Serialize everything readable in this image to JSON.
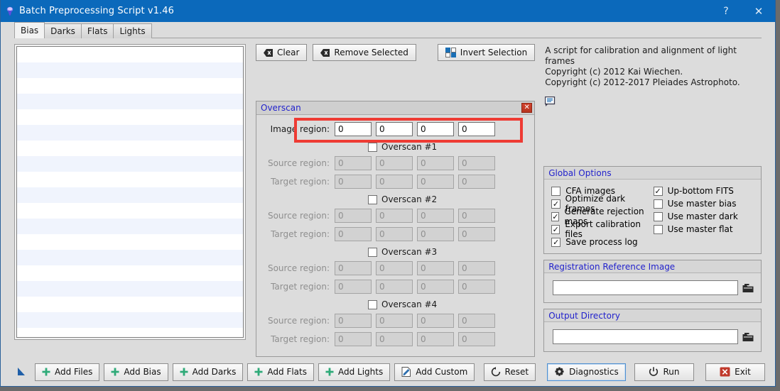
{
  "window": {
    "title": "Batch Preprocessing Script v1.46",
    "title_icon": "pixinsight-script-icon",
    "help_label": "?",
    "close_label": "✕",
    "titlebar_color": "#0b69bb"
  },
  "tabs": [
    {
      "label": "Bias",
      "active": true
    },
    {
      "label": "Darks",
      "active": false
    },
    {
      "label": "Flats",
      "active": false
    },
    {
      "label": "Lights",
      "active": false
    }
  ],
  "file_list": {
    "items": [],
    "row_count": 19
  },
  "toolbar": {
    "clear_label": "Clear",
    "remove_selected_label": "Remove Selected",
    "invert_selection_label": "Invert Selection"
  },
  "overscan": {
    "title": "Overscan",
    "close_label": "✕",
    "image_region": {
      "label": "Image region:",
      "values": [
        "0",
        "0",
        "0",
        "0"
      ],
      "enabled": true
    },
    "source_label": "Source region:",
    "target_label": "Target region:",
    "sections": [
      {
        "label": "Overscan #1",
        "checked": false,
        "source_values": [
          "0",
          "0",
          "0",
          "0"
        ],
        "target_values": [
          "0",
          "0",
          "0",
          "0"
        ]
      },
      {
        "label": "Overscan #2",
        "checked": false,
        "source_values": [
          "0",
          "0",
          "0",
          "0"
        ],
        "target_values": [
          "0",
          "0",
          "0",
          "0"
        ]
      },
      {
        "label": "Overscan #3",
        "checked": false,
        "source_values": [
          "0",
          "0",
          "0",
          "0"
        ],
        "target_values": [
          "0",
          "0",
          "0",
          "0"
        ]
      },
      {
        "label": "Overscan #4",
        "checked": false,
        "source_values": [
          "0",
          "0",
          "0",
          "0"
        ],
        "target_values": [
          "0",
          "0",
          "0",
          "0"
        ]
      }
    ],
    "highlight_color": "#ee3b34"
  },
  "description": {
    "line1": "A script for calibration and alignment of light",
    "line2": "frames",
    "line3": "Copyright (c) 2012 Kai Wiechen.",
    "line4": "Copyright (c) 2012-2017 Pleiades Astrophoto.",
    "bubble_icon": "comment-bubble-icon"
  },
  "global_options": {
    "title": "Global Options",
    "left": [
      {
        "label": "CFA images",
        "checked": false
      },
      {
        "label": "Optimize dark frames",
        "checked": true
      },
      {
        "label": "Generate rejection maps",
        "checked": true
      },
      {
        "label": "Export calibration files",
        "checked": true
      },
      {
        "label": "Save process log",
        "checked": true
      }
    ],
    "right": [
      {
        "label": "Up-bottom FITS",
        "checked": true
      },
      {
        "label": "Use master bias",
        "checked": false
      },
      {
        "label": "Use master dark",
        "checked": false
      },
      {
        "label": "Use master flat",
        "checked": false
      }
    ]
  },
  "registration_reference": {
    "title": "Registration Reference Image",
    "value": "",
    "placeholder": "",
    "browse_icon": "folder-icon"
  },
  "output_directory": {
    "title": "Output Directory",
    "value": "",
    "placeholder": "",
    "browse_icon": "folder-icon"
  },
  "bottom_toolbar": {
    "arrow_icon": "triangle-pointer-icon",
    "add_files_label": "Add Files",
    "add_bias_label": "Add Bias",
    "add_darks_label": "Add Darks",
    "add_flats_label": "Add Flats",
    "add_lights_label": "Add Lights",
    "add_custom_label": "Add Custom",
    "reset_label": "Reset",
    "diagnostics_label": "Diagnostics",
    "run_label": "Run",
    "exit_label": "Exit",
    "plus_color": "#2eaa78",
    "exit_icon_color": "#c0392b"
  },
  "colors": {
    "accent_blue": "#2222cc",
    "title_blue": "#0b69bb",
    "panel_gray": "#dcdcdc"
  }
}
